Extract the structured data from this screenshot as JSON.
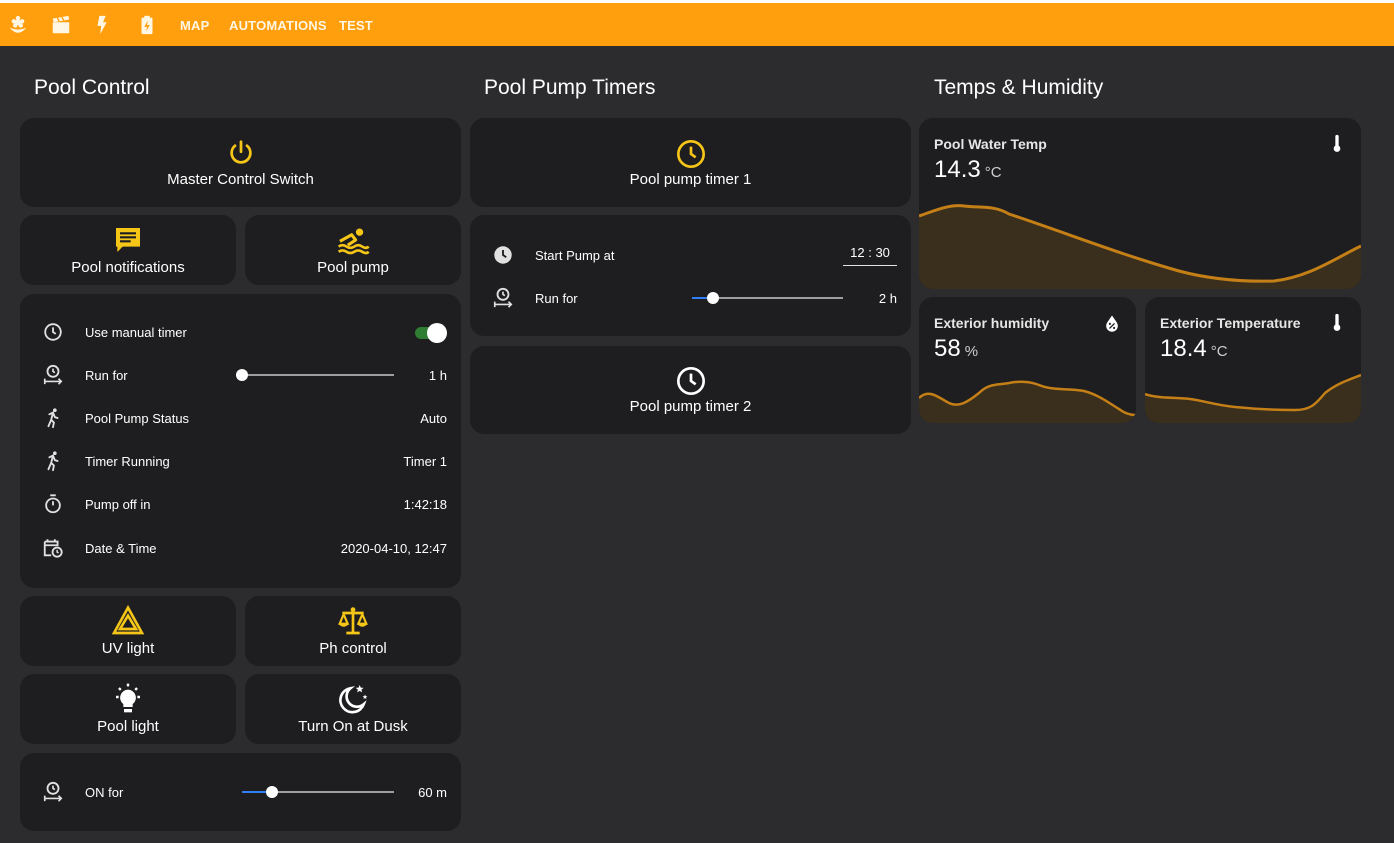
{
  "colors": {
    "accent": "#ff9f0d",
    "icon_yellow": "#f5c518",
    "card_bg": "#1e1e20",
    "page_bg": "#2c2c2e",
    "graph_line": "#c47f17",
    "toggle_on": "#4caf50",
    "slider_blue": "#2f7ef5"
  },
  "topbar": {
    "icons": [
      "flower-icon",
      "clapperboard-icon",
      "lightning-icon",
      "battery-charging-icon"
    ],
    "links": [
      "MAP",
      "AUTOMATIONS",
      "TEST"
    ]
  },
  "pool_control": {
    "title": "Pool Control",
    "master": {
      "label": "Master Control Switch",
      "icon": "power-icon"
    },
    "notifications": {
      "label": "Pool notifications",
      "icon": "message-text-icon"
    },
    "pump": {
      "label": "Pool pump",
      "icon": "swimmer-icon"
    },
    "entities": {
      "manual_timer": {
        "label": "Use manual timer",
        "state": "on",
        "icon": "clock-icon"
      },
      "run_for": {
        "label": "Run for",
        "value": "1 h",
        "slider_fraction": 0.0,
        "icon": "timer-range-icon"
      },
      "status": {
        "label": "Pool Pump Status",
        "value": "Auto",
        "icon": "run-icon"
      },
      "timer_running": {
        "label": "Timer Running",
        "value": "Timer 1",
        "icon": "run-icon"
      },
      "pump_off_in": {
        "label": "Pump off in",
        "value": "1:42:18",
        "icon": "stopwatch-icon"
      },
      "datetime": {
        "label": "Date & Time",
        "value": "2020-04-10, 12:47",
        "icon": "calendar-clock-icon"
      }
    },
    "uv": {
      "label": "UV light",
      "icon": "warning-triangle-icon"
    },
    "ph": {
      "label": "Ph control",
      "icon": "scale-icon"
    },
    "light": {
      "label": "Pool light",
      "icon": "lightbulb-icon"
    },
    "dusk": {
      "label": "Turn On at Dusk",
      "icon": "moon-stars-icon"
    },
    "on_for": {
      "label": "ON for",
      "value": "60 m",
      "slider_fraction": 0.2,
      "icon": "timer-range-icon"
    }
  },
  "timers": {
    "title": "Pool Pump Timers",
    "timer1": {
      "label": "Pool pump timer 1",
      "icon": "clock-icon"
    },
    "start": {
      "label": "Start Pump at",
      "hour": "12",
      "separator": ":",
      "minute": "30",
      "icon": "clock-icon"
    },
    "run_for": {
      "label": "Run for",
      "value": "2 h",
      "slider_fraction": 0.14,
      "icon": "timer-range-icon"
    },
    "timer2": {
      "label": "Pool pump timer 2",
      "icon": "clock-icon"
    }
  },
  "temps": {
    "title": "Temps & Humidity",
    "water": {
      "name": "Pool Water Temp",
      "value": "14.3",
      "unit": "°C",
      "icon": "thermometer-icon"
    },
    "humidity": {
      "name": "Exterior humidity",
      "value": "58",
      "unit": "%",
      "icon": "water-percent-icon"
    },
    "ext_temp": {
      "name": "Exterior Temperature",
      "value": "18.4",
      "unit": "°C",
      "icon": "thermometer-icon"
    }
  }
}
